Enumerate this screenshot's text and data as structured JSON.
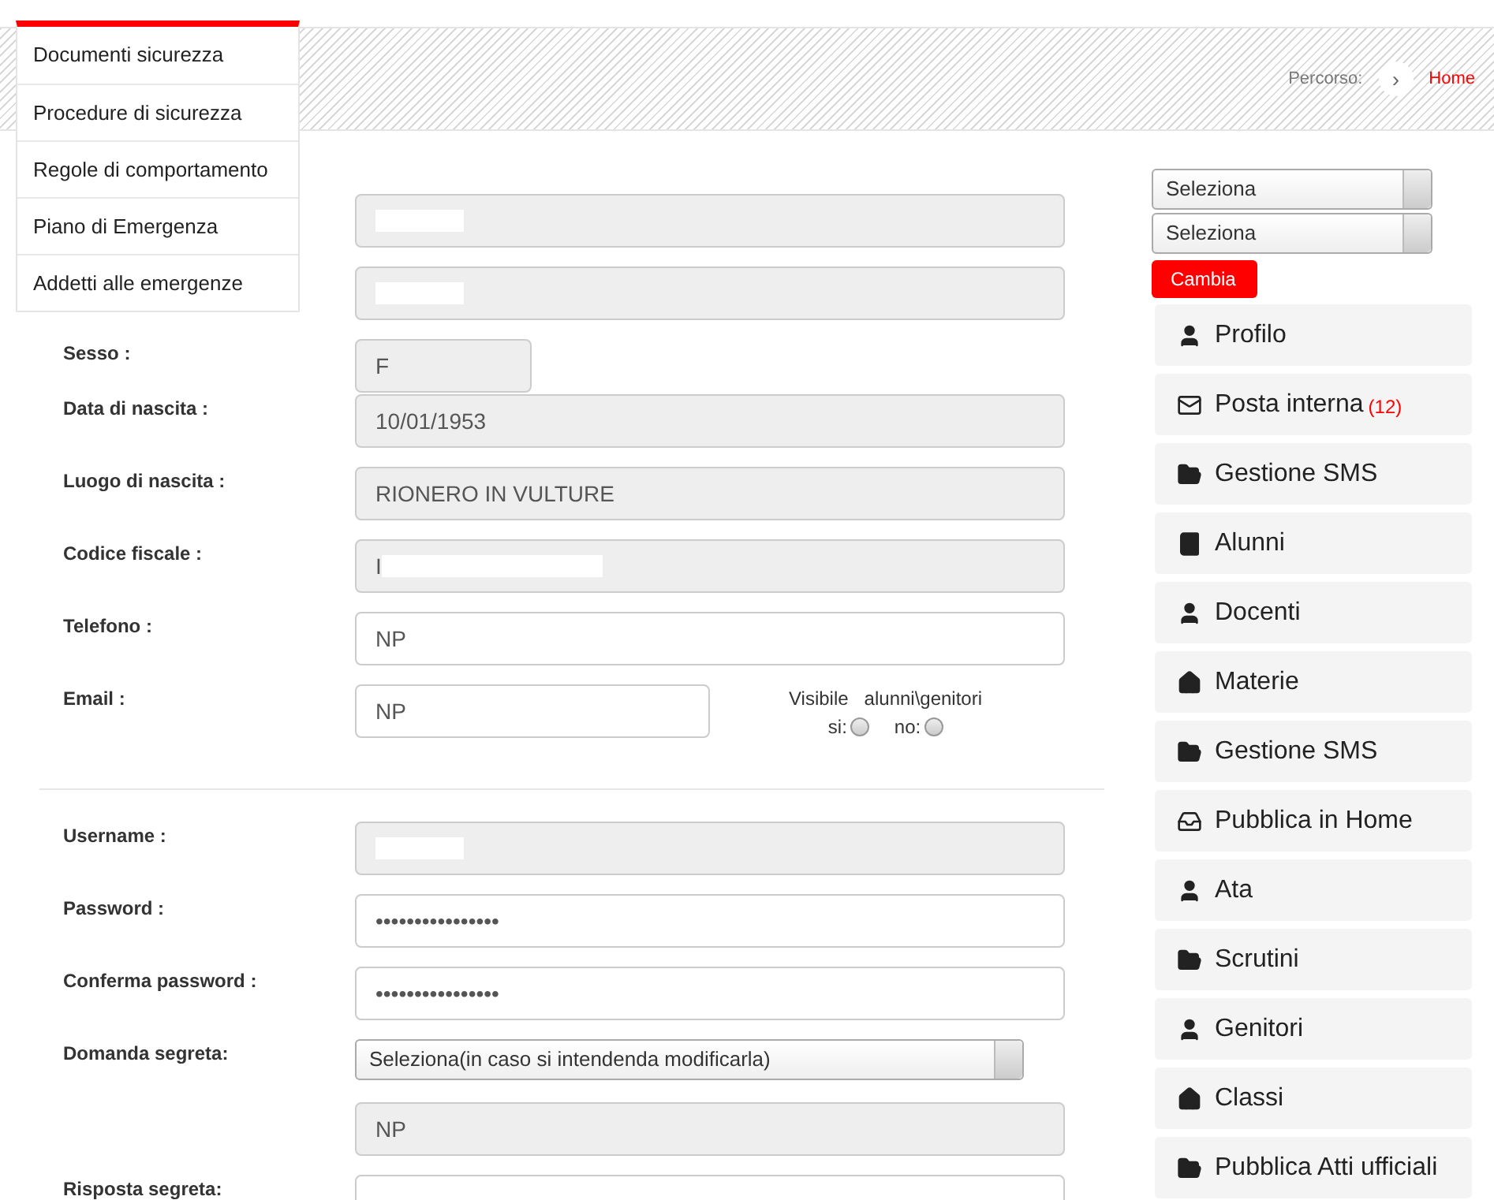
{
  "dropdown_menu": {
    "items": [
      {
        "label": "Documenti sicurezza"
      },
      {
        "label": "Procedure di sicurezza"
      },
      {
        "label": "Regole di comportamento"
      },
      {
        "label": "Piano di Emergenza"
      },
      {
        "label": "Addetti alle emergenze"
      }
    ]
  },
  "breadcrumb": {
    "label": "Percorso:",
    "separator": "›",
    "link": "Home"
  },
  "personal_fields": [
    {
      "kind": "text",
      "readonly": true,
      "redacted": true
    },
    {
      "kind": "text",
      "readonly": true,
      "redacted": true
    },
    {
      "kind": "short",
      "label": "Sesso :",
      "value": "F",
      "readonly": true
    },
    {
      "kind": "text",
      "label": "Data di nascita :",
      "value": "10/01/1953",
      "readonly": true
    },
    {
      "kind": "text",
      "label": "Luogo di nascita :",
      "value": "RIONERO IN VULTURE",
      "readonly": true
    },
    {
      "kind": "text",
      "label": "Codice fiscale :",
      "value": "I",
      "readonly": true,
      "redacted": true
    },
    {
      "kind": "text",
      "label": "Telefono :",
      "value": "NP",
      "readonly": false
    },
    {
      "kind": "email",
      "label": "Email :",
      "value": "NP",
      "readonly": false,
      "visibility": {
        "title": "Visibile   alunni\\genitori",
        "options": [
          {
            "label": "si:",
            "checked": false
          },
          {
            "label": "no:",
            "checked": false
          }
        ]
      }
    }
  ],
  "account_fields": [
    {
      "kind": "text",
      "label": "Username :",
      "readonly": true,
      "redacted": true
    },
    {
      "kind": "password",
      "label": "Password :",
      "value": "••••••••••••••••",
      "readonly": false
    },
    {
      "kind": "password",
      "label": "Conferma password :",
      "value": "••••••••••••••••",
      "readonly": false
    },
    {
      "kind": "select",
      "label": "Domanda segreta:",
      "value": "Seleziona(in caso si intendenda modificarla)"
    },
    {
      "kind": "text",
      "value": "NP",
      "readonly": true
    },
    {
      "kind": "text",
      "label": "Risposta segreta:",
      "readonly": false
    }
  ],
  "sidebar": {
    "selects": [
      {
        "value": "Seleziona"
      },
      {
        "value": "Seleziona"
      }
    ],
    "button": "Cambia",
    "items": [
      {
        "kind": "person",
        "label": "Profilo"
      },
      {
        "kind": "mail",
        "label": "Posta interna",
        "badge": "(12)"
      },
      {
        "kind": "folder",
        "label": "Gestione SMS"
      },
      {
        "kind": "book",
        "label": "Alunni"
      },
      {
        "kind": "person",
        "label": "Docenti"
      },
      {
        "kind": "house",
        "label": "Materie"
      },
      {
        "kind": "folder",
        "label": "Gestione SMS"
      },
      {
        "kind": "tray",
        "label": "Pubblica in Home"
      },
      {
        "kind": "person",
        "label": "Ata"
      },
      {
        "kind": "folder",
        "label": "Scrutini"
      },
      {
        "kind": "person",
        "label": "Genitori"
      },
      {
        "kind": "house",
        "label": "Classi"
      },
      {
        "kind": "folder",
        "label": "Pubblica Atti ufficiali"
      }
    ]
  }
}
